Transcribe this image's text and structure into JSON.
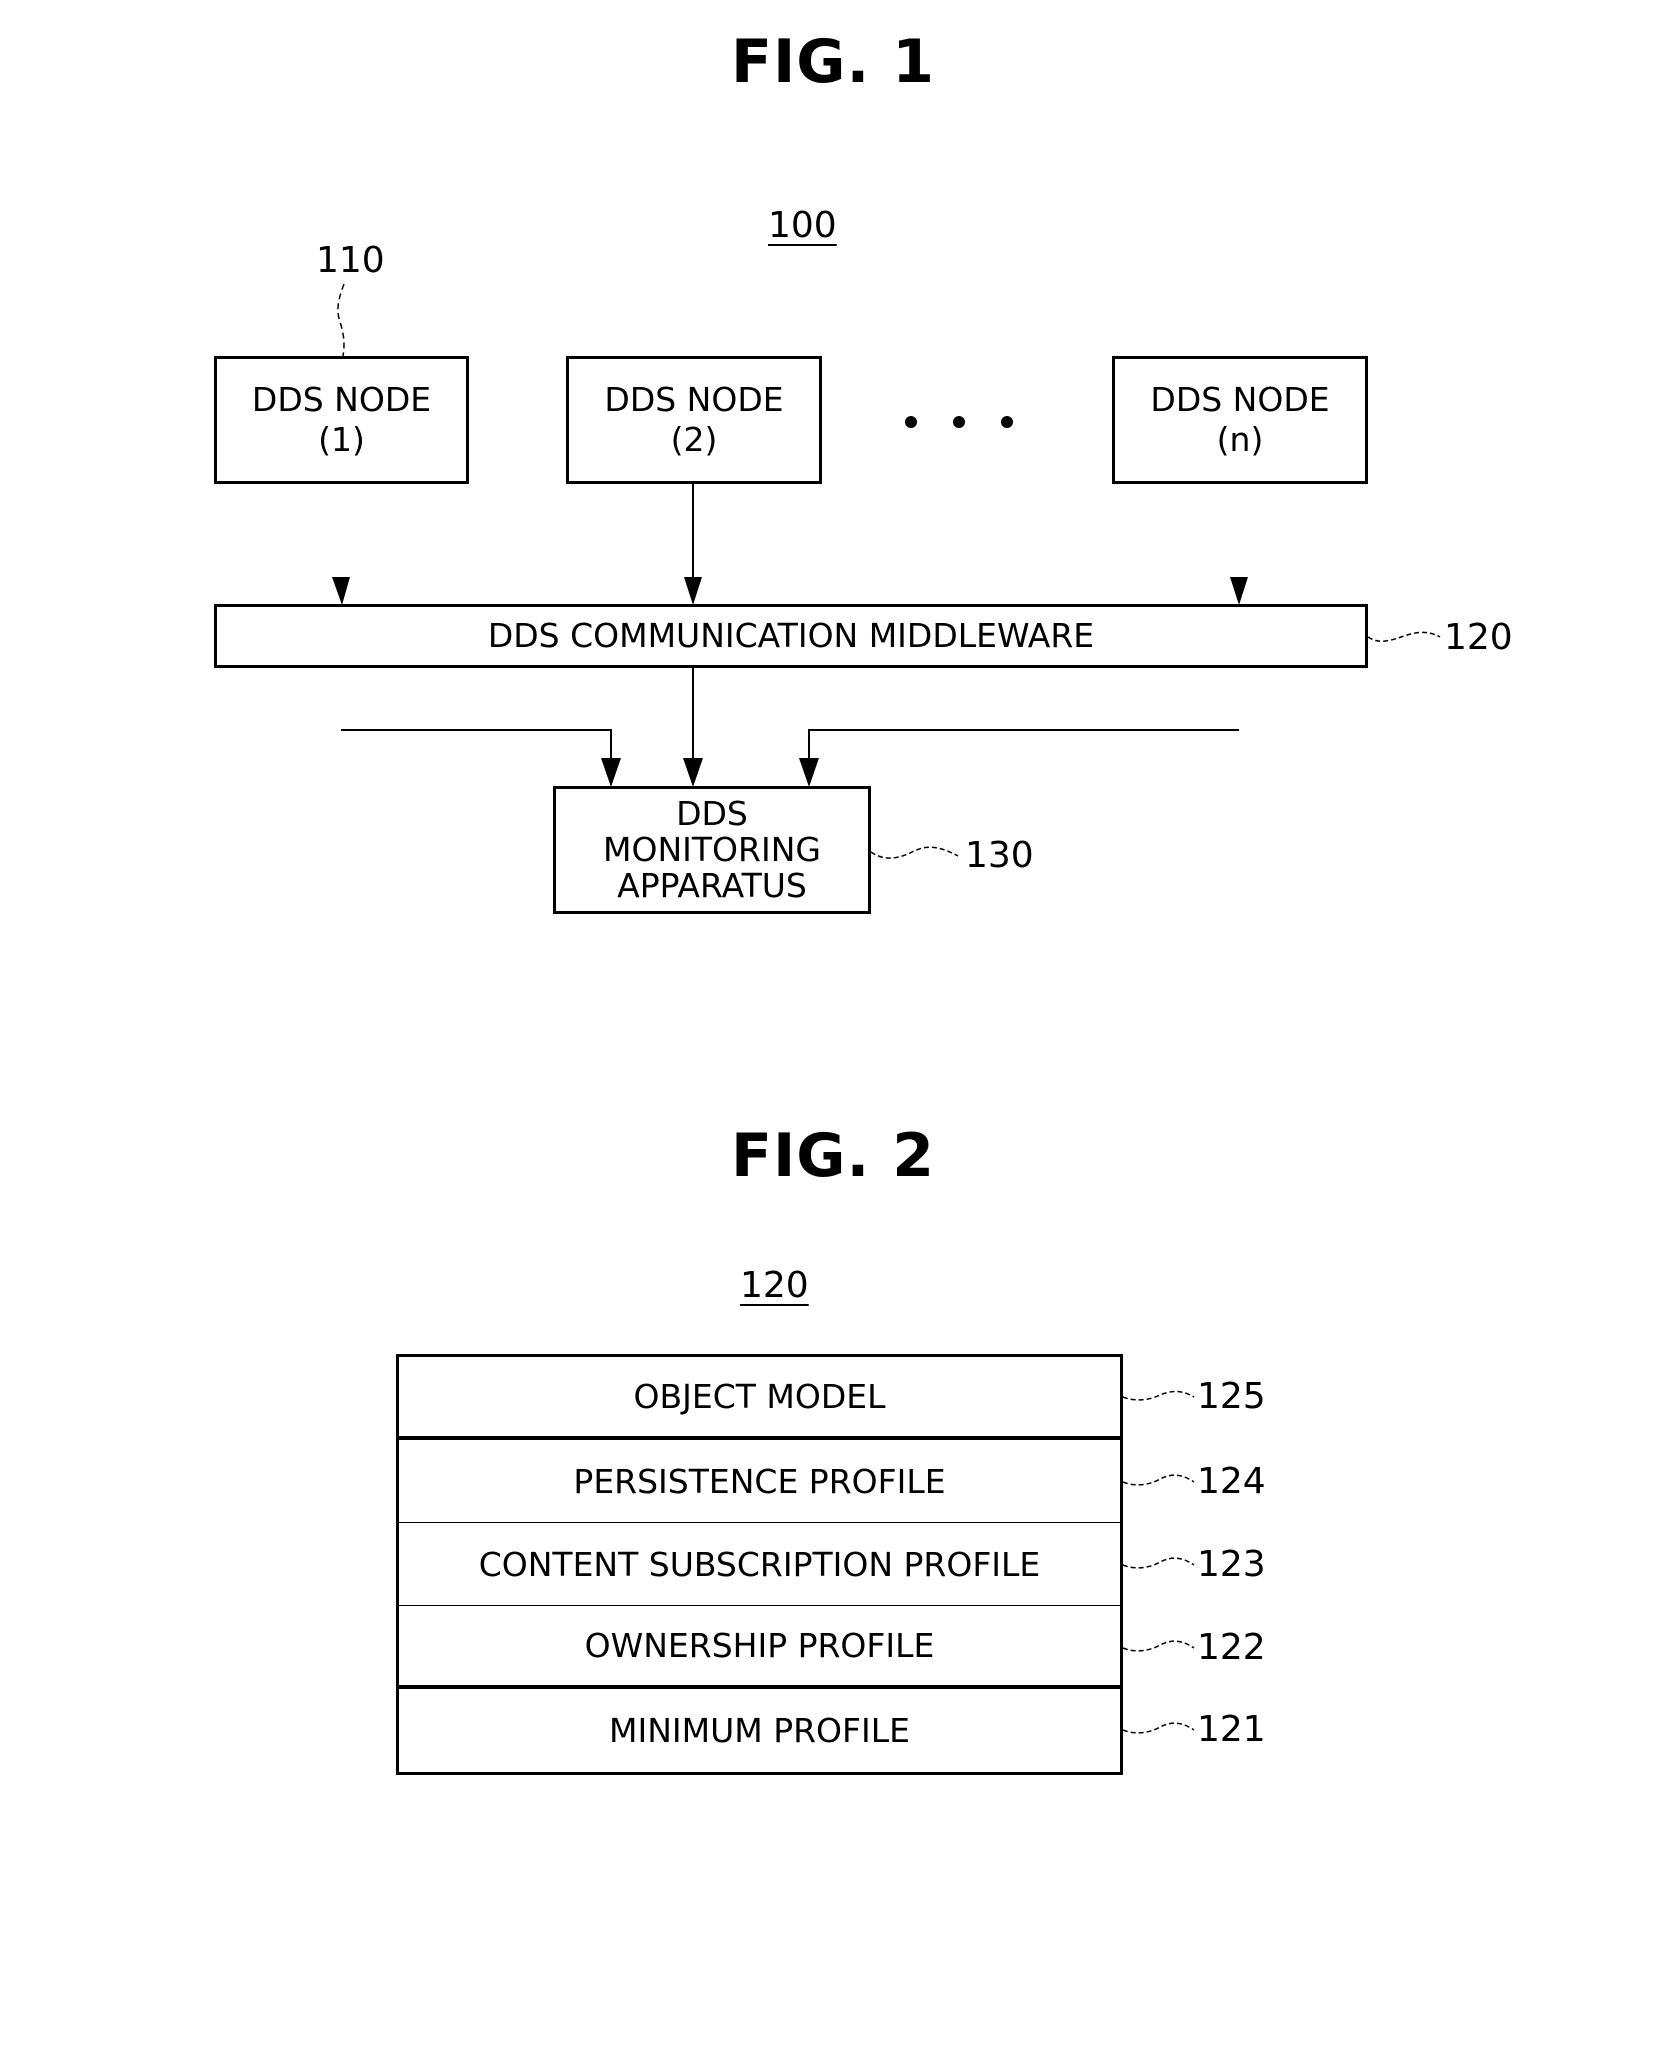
{
  "figure1": {
    "title": "FIG. 1",
    "system_ref": "100",
    "node_ref": "110",
    "nodes": [
      {
        "label": "DDS NODE\n(1)"
      },
      {
        "label": "DDS NODE\n(2)"
      },
      {
        "label": "DDS NODE\n(n)"
      }
    ],
    "ellipsis": "• • •",
    "middleware": {
      "label": "DDS COMMUNICATION MIDDLEWARE",
      "ref": "120"
    },
    "monitor": {
      "label": "DDS\nMONITORING\nAPPARATUS",
      "ref": "130"
    }
  },
  "figure2": {
    "title": "FIG. 2",
    "stack_ref": "120",
    "layers": [
      {
        "label": "OBJECT MODEL",
        "ref": "125"
      },
      {
        "label": "PERSISTENCE PROFILE",
        "ref": "124"
      },
      {
        "label": "CONTENT SUBSCRIPTION PROFILE",
        "ref": "123"
      },
      {
        "label": "OWNERSHIP PROFILE",
        "ref": "122"
      },
      {
        "label": "MINIMUM PROFILE",
        "ref": "121"
      }
    ]
  }
}
